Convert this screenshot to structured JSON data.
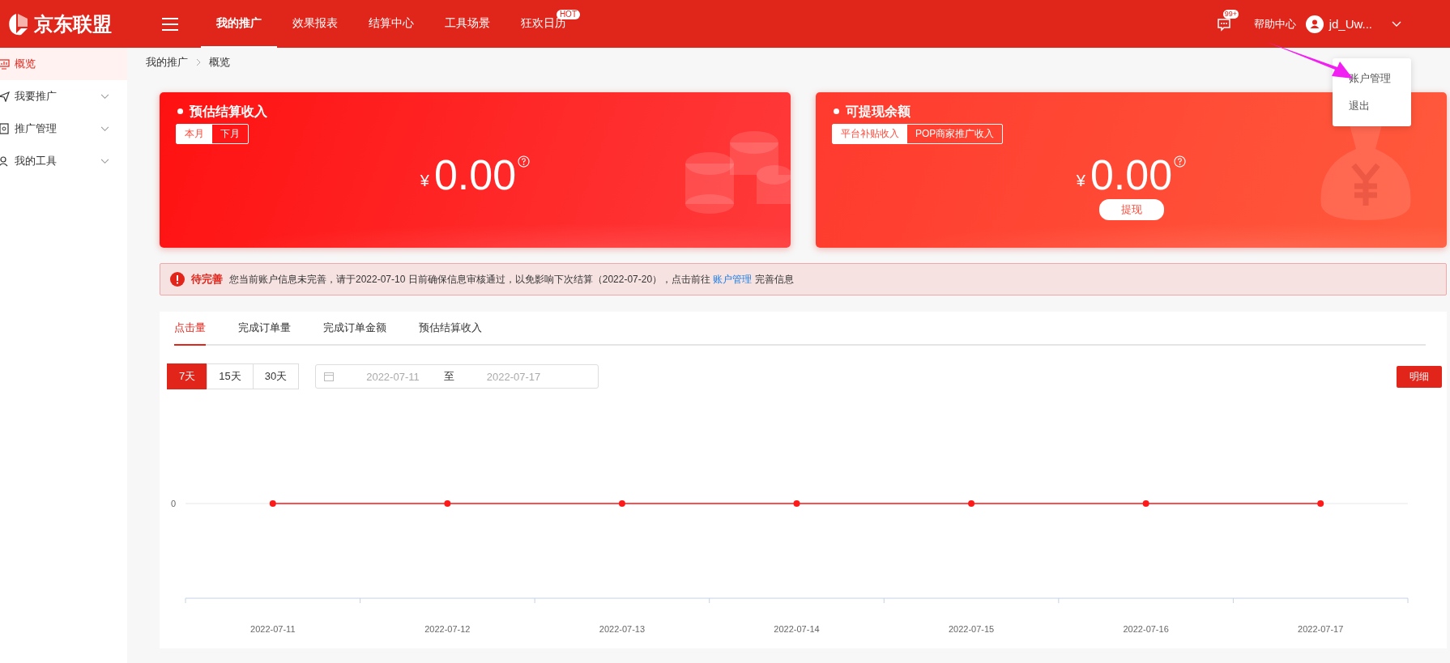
{
  "header": {
    "logo_text": "京东联盟",
    "nav": [
      {
        "label": "我的推广",
        "selected": true
      },
      {
        "label": "效果报表",
        "selected": false
      },
      {
        "label": "结算中心",
        "selected": false
      },
      {
        "label": "工具场景",
        "selected": false
      },
      {
        "label": "狂欢日历",
        "selected": false,
        "badge": "HOT"
      }
    ],
    "message_badge": "99+",
    "help": "帮助中心",
    "user": "jd_Uw..."
  },
  "user_menu": {
    "items": [
      "账户管理",
      "退出"
    ]
  },
  "sidebar": {
    "items": [
      {
        "label": "概览",
        "selected": true,
        "expandable": false,
        "kind": "monitor"
      },
      {
        "label": "我要推广",
        "selected": false,
        "expandable": true,
        "kind": "plane"
      },
      {
        "label": "推广管理",
        "selected": false,
        "expandable": true,
        "kind": "box"
      },
      {
        "label": "我的工具",
        "selected": false,
        "expandable": true,
        "kind": "person"
      }
    ]
  },
  "breadcrumb": [
    "我的推广",
    "概览"
  ],
  "cards": [
    {
      "kind": "coins",
      "title": "预估结算收入",
      "toggles": [
        {
          "label": "本月",
          "selected": true
        },
        {
          "label": "下月",
          "selected": false
        }
      ],
      "currency": "¥",
      "amount": "0.00"
    },
    {
      "kind": "bag",
      "title": "可提现余额",
      "toggles": [
        {
          "label": "平台补贴收入",
          "selected": true
        },
        {
          "label": "POP商家推广收入",
          "selected": false
        }
      ],
      "currency": "¥",
      "amount": "0.00",
      "button": "提现"
    }
  ],
  "alert": {
    "title": "待完善",
    "text": "您当前账户信息未完善，请于2022-07-10 日前确保信息审核通过，以免影响下次结算（2022-07-20），点击前往",
    "link": "账户管理",
    "text_after": "完善信息"
  },
  "panel": {
    "tabs": [
      {
        "label": "点击量",
        "selected": true
      },
      {
        "label": "完成订单量",
        "selected": false
      },
      {
        "label": "完成订单金额",
        "selected": false
      },
      {
        "label": "预估结算收入",
        "selected": false
      }
    ],
    "ranges": [
      {
        "label": "7天",
        "selected": true
      },
      {
        "label": "15天",
        "selected": false
      },
      {
        "label": "30天",
        "selected": false
      }
    ],
    "date_from": "2022-07-11",
    "date_separator": "至",
    "date_to": "2022-07-17",
    "detail_button": "明细",
    "y_axis_label": "0",
    "x_axis_labels": [
      "2022-07-11",
      "2022-07-12",
      "2022-07-13",
      "2022-07-14",
      "2022-07-15",
      "2022-07-16",
      "2022-07-17"
    ]
  }
}
